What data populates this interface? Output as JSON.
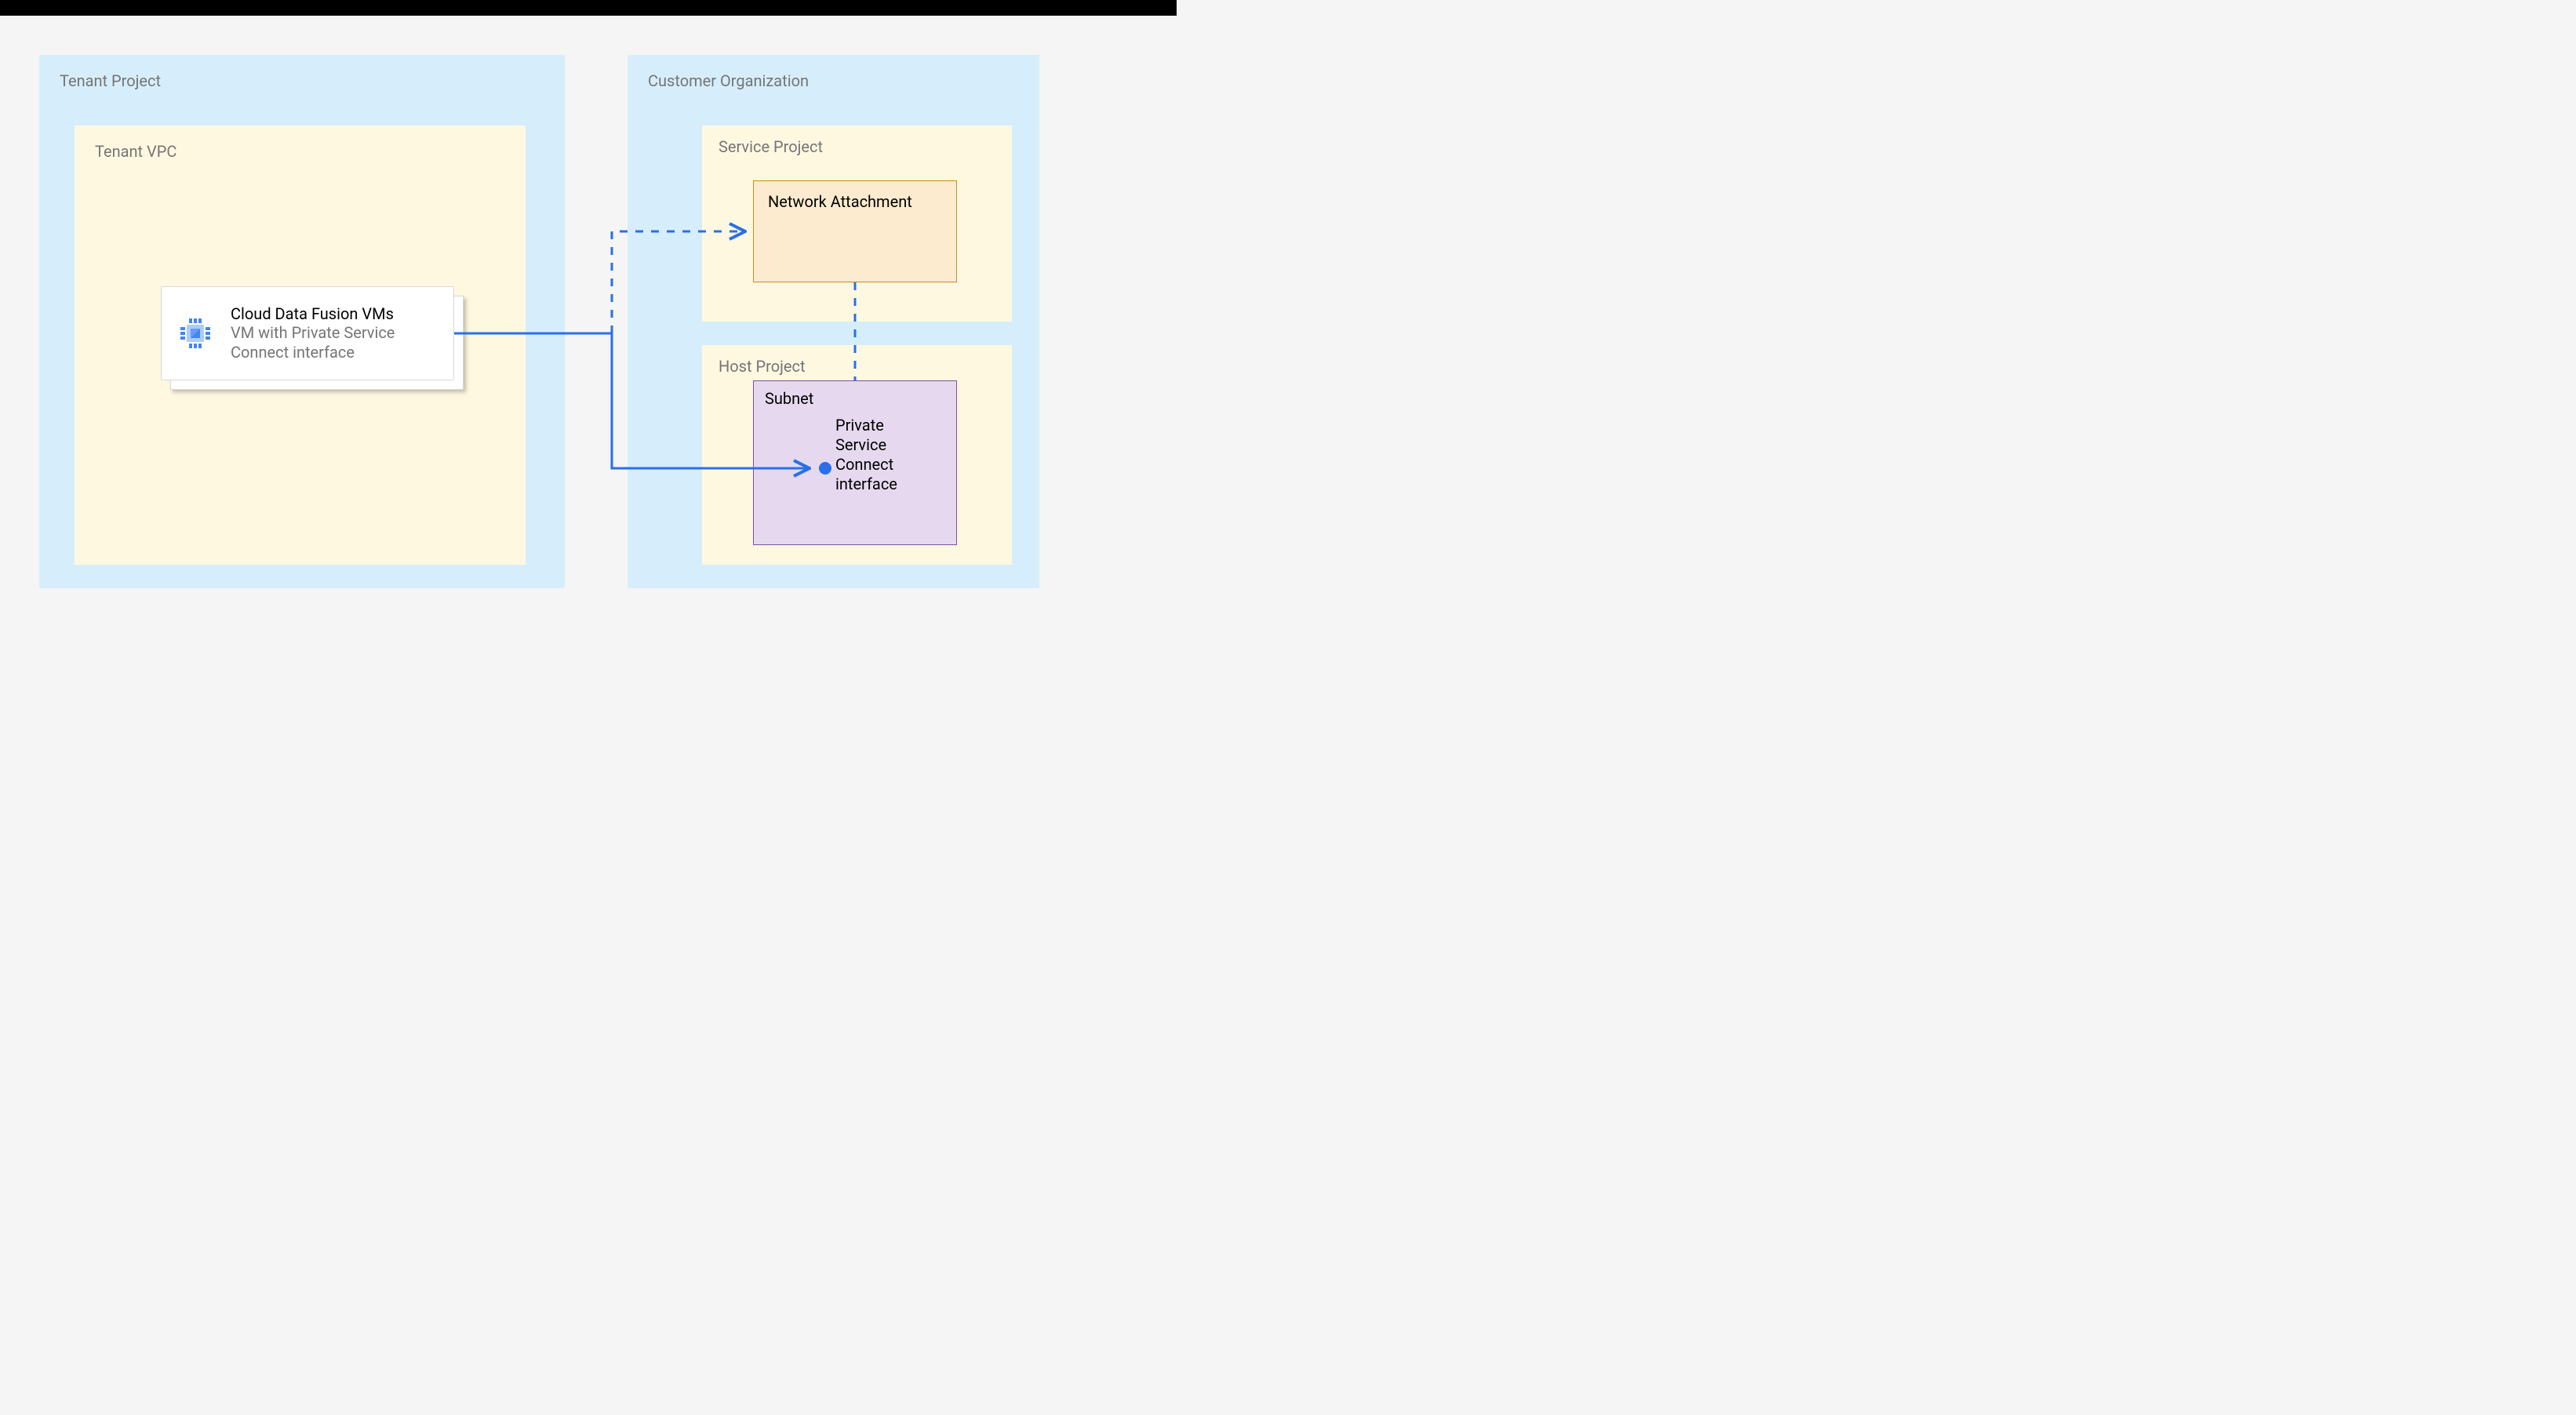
{
  "tenantProject": {
    "label": "Tenant Project"
  },
  "tenantVpc": {
    "label": "Tenant VPC"
  },
  "vmCard": {
    "title": "Cloud Data Fusion VMs",
    "subtitle": "VM with Private Service Connect interface"
  },
  "customerOrg": {
    "label": "Customer Organization"
  },
  "serviceProject": {
    "label": "Service Project"
  },
  "networkAttachment": {
    "label": "Network Attachment"
  },
  "hostProject": {
    "label": "Host Project"
  },
  "subnet": {
    "label": "Subnet"
  },
  "pscInterface": {
    "label": "Private Service Connect interface"
  },
  "colors": {
    "blueLine": "#2a6fe8",
    "lightBlueBg": "#d6eefc",
    "creamBg": "#fff8e1",
    "peachBg": "#fdebd0",
    "peachBorder": "#c78b1e",
    "lavenderBg": "#e6d9ef",
    "lavenderBorder": "#7b519d"
  }
}
